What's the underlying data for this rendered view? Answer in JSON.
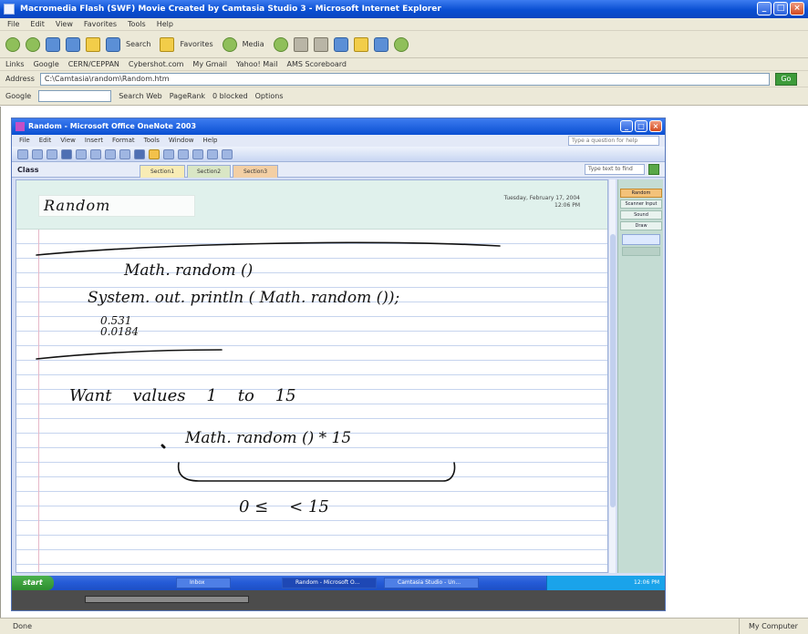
{
  "ie": {
    "title": "Macromedia Flash (SWF) Movie Created by Camtasia Studio 3 - Microsoft Internet Explorer",
    "menu": [
      "File",
      "Edit",
      "View",
      "Favorites",
      "Tools",
      "Help"
    ],
    "toolbar": {
      "search_label": "Search",
      "favorites_label": "Favorites",
      "media_label": "Media"
    },
    "links_label": "Links",
    "links": [
      "Google",
      "CERN/CEPPAN",
      "Cybershot.com",
      "My Gmail",
      "Yahoo! Mail",
      "AMS Scoreboard"
    ],
    "address_label": "Address",
    "address_value": "C:\\Camtasia\\random\\Random.htm",
    "go_label": "Go",
    "google_label": "Google",
    "google_items": [
      "Search Web",
      "PageRank",
      "0 blocked",
      "Options"
    ],
    "status_text": "Done",
    "status_zone": "My Computer"
  },
  "onenote": {
    "title": "Random - Microsoft Office OneNote 2003",
    "menu": [
      "File",
      "Edit",
      "View",
      "Insert",
      "Format",
      "Tools",
      "Window",
      "Help"
    ],
    "help_placeholder": "Type a question for help",
    "section_name": "Class",
    "tabs": [
      "Section1",
      "Section2",
      "Section3"
    ],
    "search_placeholder": "Type text to find",
    "page_title": "Random",
    "date": "Tuesday, February 17, 2004",
    "time": "12:06 PM",
    "page_tabs": [
      "Random",
      "Scanner Input",
      "Sound",
      "Draw"
    ],
    "taskbar": {
      "start_label": "start",
      "tasks": [
        "Inbox",
        "Random - Microsoft O...",
        "Camtasia Studio - Un..."
      ],
      "clock": "12:06 PM"
    }
  },
  "ink": {
    "line1": "Math. random ()",
    "line2": "System. out. println ( Math. random ());",
    "line3a": "0.531",
    "line3b": "0.0184",
    "line4": "Want    values    1    to    15",
    "line5": "Math. random ()  * 15",
    "line6": "0 ≤    < 15"
  }
}
